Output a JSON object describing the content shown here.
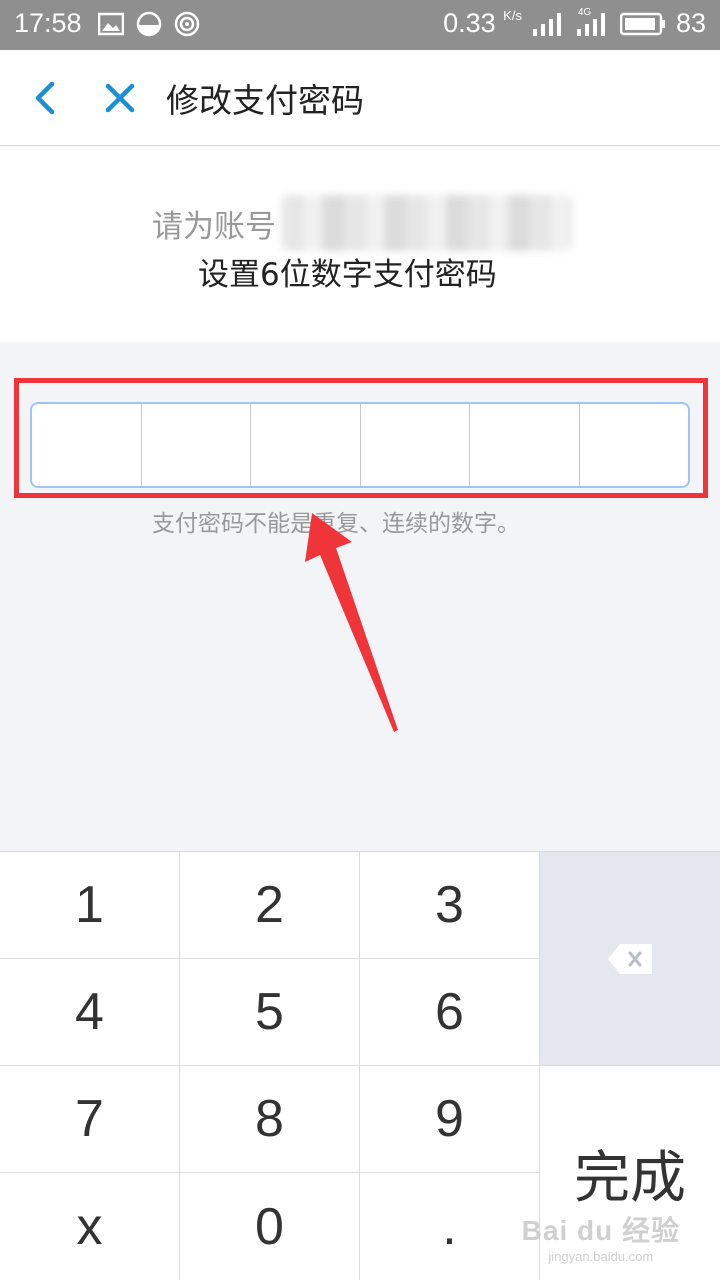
{
  "status_bar": {
    "time": "17:58",
    "speed": "0.33",
    "speed_unit": "K/s",
    "network": "4G",
    "battery": "83",
    "icons": [
      "image-icon",
      "weather-icon",
      "hotspot-icon",
      "signal-icon",
      "signal-4g-icon",
      "battery-icon"
    ]
  },
  "header": {
    "title": "修改支付密码",
    "back_icon": "chevron-left-icon",
    "close_icon": "close-icon",
    "accent_color": "#1a8fd5"
  },
  "prompt": {
    "line1": "请为账号",
    "line2": "设置6位数字支付密码"
  },
  "password": {
    "digits": [
      "",
      "",
      "",
      "",
      "",
      ""
    ],
    "hint": "支付密码不能是重复、连续的数字。",
    "highlight_color": "#f0353a"
  },
  "keypad": {
    "keys": [
      "1",
      "2",
      "3",
      "4",
      "5",
      "6",
      "7",
      "8",
      "9",
      "x",
      "0",
      "."
    ],
    "delete_icon": "backspace-icon",
    "done_label": "完成"
  },
  "watermark": {
    "logo": "Bai du 经验",
    "url": "jingyan.baidu.com"
  }
}
